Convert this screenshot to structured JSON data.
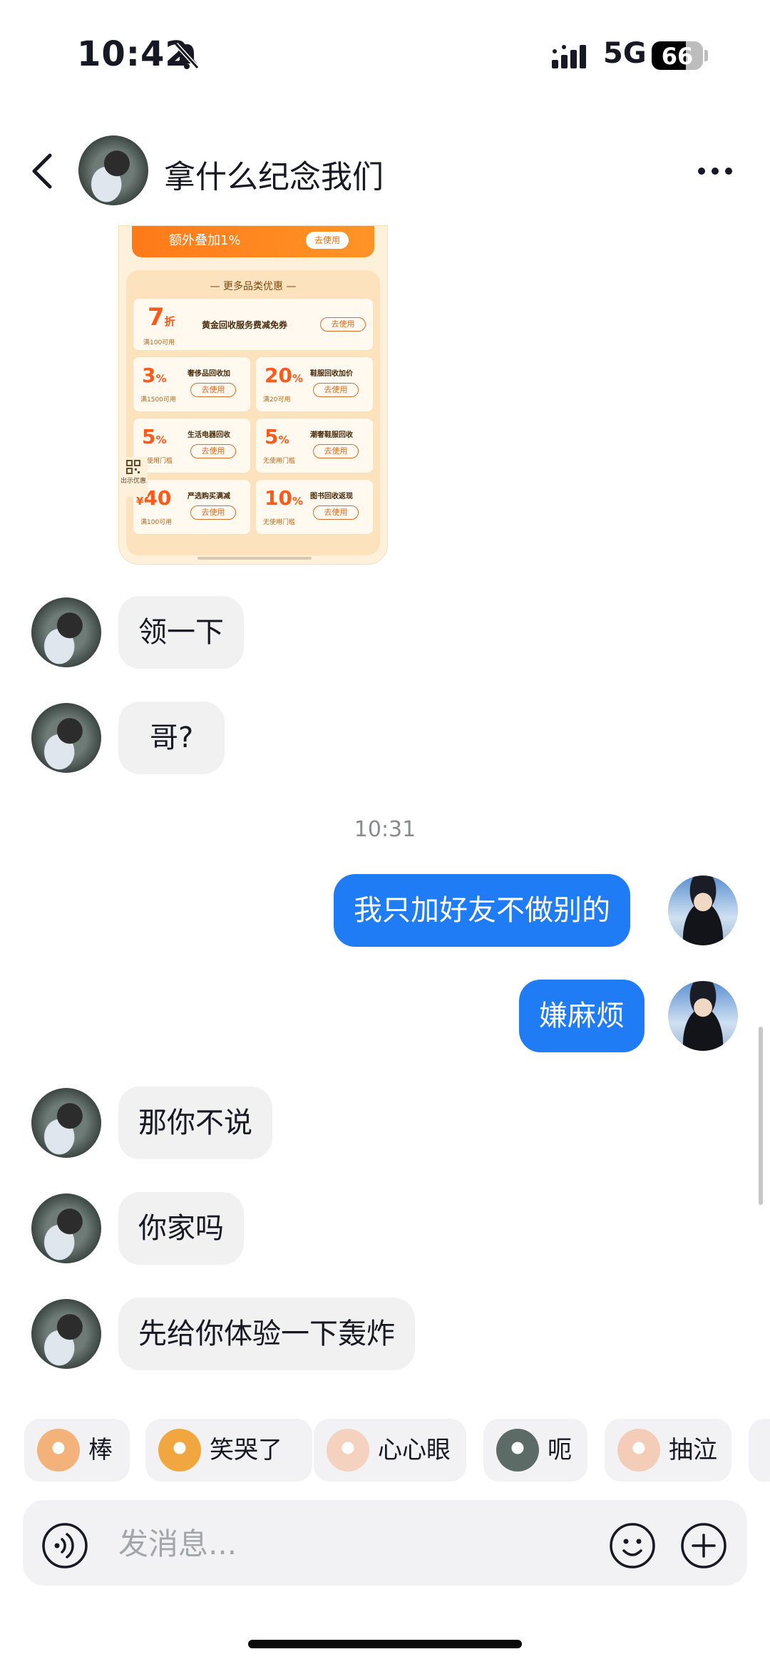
{
  "status_bar": {
    "time": "10:42",
    "network": "5G",
    "battery": "66",
    "battery_level": 0.66,
    "icons": [
      "bell-off-icon",
      "signal-icon"
    ]
  },
  "header": {
    "title": "拿什么纪念我们",
    "icons": [
      "back-arrow-icon",
      "more-options-icon"
    ]
  },
  "coupon_image": {
    "top_text": "额外叠加1%",
    "top_btn": "去使用",
    "panel_title": "— 更多品类优惠 —",
    "wide": {
      "big": "7",
      "unit": "折",
      "sub": "满100可用",
      "name": "黄金回收服务费减免券",
      "btn": "去使用"
    },
    "cards": [
      {
        "big": "3",
        "unit": "%",
        "sub": "满1500可用",
        "name": "奢侈品回收加",
        "btn": "去使用"
      },
      {
        "big": "20",
        "unit": "%",
        "sub": "满20可用",
        "name": "鞋服回收加价",
        "btn": "去使用"
      },
      {
        "big": "5",
        "unit": "%",
        "sub": "无使用门槛",
        "name": "生活电器回收",
        "btn": "去使用"
      },
      {
        "big": "5",
        "unit": "%",
        "sub": "无使用门槛",
        "name": "潮奢鞋服回收",
        "btn": "去使用"
      },
      {
        "big": "40",
        "unit": "¥",
        "sub": "满100可用",
        "name": "严选购买满减",
        "btn": "去使用"
      },
      {
        "big": "10",
        "unit": "%",
        "sub": "无使用门槛",
        "name": "图书回收返现",
        "btn": "去使用"
      }
    ],
    "qr_label": "出示优惠"
  },
  "messages": [
    {
      "side": "in",
      "text": "领一下"
    },
    {
      "side": "in",
      "text": "哥?"
    },
    {
      "side": "out",
      "text": "我只加好友不做别的"
    },
    {
      "side": "out",
      "text": "嫌麻烦"
    },
    {
      "side": "in",
      "text": "那你不说"
    },
    {
      "side": "in",
      "text": "你家吗"
    },
    {
      "side": "in",
      "text": "先给你体验一下轰炸"
    }
  ],
  "time_separator": "10:31",
  "emoji_suggestions": [
    {
      "label": "棒",
      "icon": "cat-thumbs-up-icon",
      "color": "#f3b27a"
    },
    {
      "label": "笑哭了",
      "icon": "dog-laugh-cry-icon",
      "color": "#f2a640"
    },
    {
      "label": "心心眼",
      "icon": "cat-heart-eyes-icon",
      "color": "#f5d1c0"
    },
    {
      "label": "呃",
      "icon": "cat-awkward-icon",
      "color": "#5c6b66"
    },
    {
      "label": "抽泣",
      "icon": "cat-sob-icon",
      "color": "#f3cdb8"
    }
  ],
  "composer": {
    "placeholder": "发消息...",
    "icons": [
      "voice-icon",
      "emoji-icon",
      "plus-icon"
    ]
  },
  "colors": {
    "outgoing_bubble": "#1f7cf5",
    "incoming_bubble": "#f1f1f2",
    "coupon_accent": "#ff6a00"
  }
}
